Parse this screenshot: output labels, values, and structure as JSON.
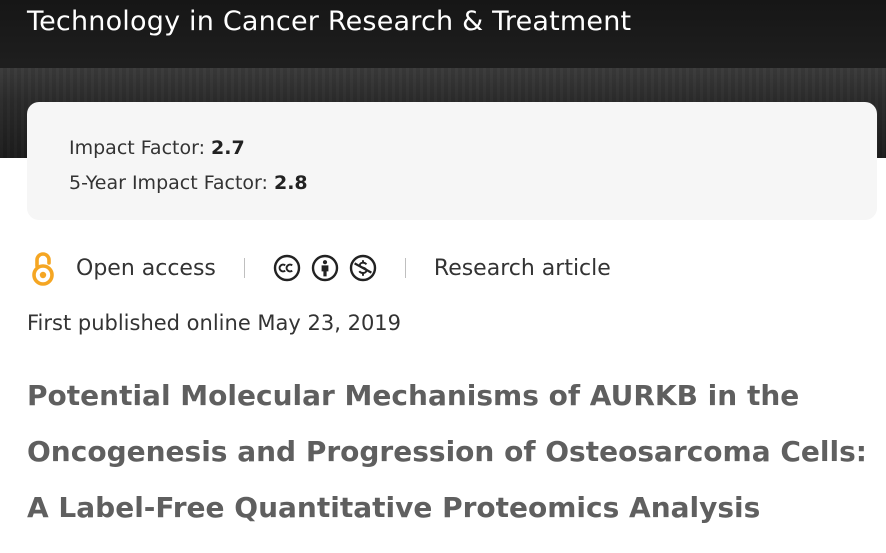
{
  "journal": {
    "title": "Technology in Cancer Research & Treatment"
  },
  "metrics": {
    "impact_factor_label": "Impact Factor:",
    "impact_factor_value": "2.7",
    "five_year_label": "5-Year Impact Factor:",
    "five_year_value": "2.8"
  },
  "meta": {
    "access_label": "Open access",
    "article_type": "Research article",
    "license_icons": [
      "cc-icon",
      "by-icon",
      "nc-icon"
    ]
  },
  "published": "First published online May 23, 2019",
  "article": {
    "title": "Potential Molecular Mechanisms of AURKB in the Oncogenesis and Progression of Osteosarcoma Cells: A Label-Free Quantitative Proteomics Analysis"
  },
  "colors": {
    "open_access_orange": "#F5A623",
    "title_gray": "#5f5f5f"
  }
}
